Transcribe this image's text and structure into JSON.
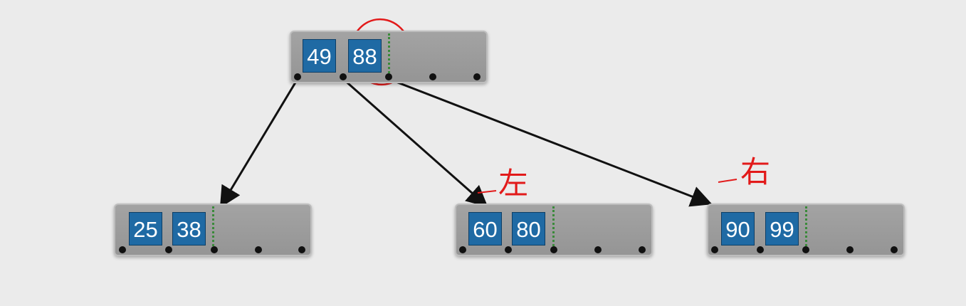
{
  "nodes": [
    {
      "id": "root",
      "keys": [
        "49",
        "88"
      ]
    },
    {
      "id": "left",
      "keys": [
        "25",
        "38"
      ]
    },
    {
      "id": "middle",
      "keys": [
        "60",
        "80"
      ]
    },
    {
      "id": "right",
      "keys": [
        "90",
        "99"
      ]
    }
  ],
  "annotations": {
    "left_label": "左",
    "right_label": "右"
  },
  "colors": {
    "key_fill": "#1f6aa4",
    "node_fill": "#9e9e9e",
    "annotation": "#e21a1a",
    "divider": "#3a8a3a"
  }
}
